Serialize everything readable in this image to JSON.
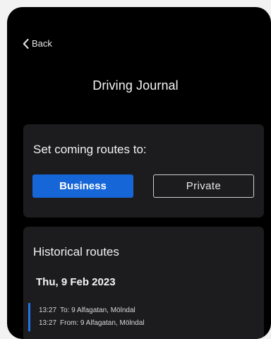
{
  "nav": {
    "back_label": "Back"
  },
  "header": {
    "title": "Driving Journal"
  },
  "routes_setting": {
    "heading": "Set coming routes to:",
    "options": [
      "Business",
      "Private"
    ],
    "selected": "Business"
  },
  "history": {
    "heading": "Historical routes",
    "days": [
      {
        "date": "Thu, 9 Feb 2023",
        "trips": [
          {
            "lines": [
              {
                "time": "13:27",
                "text": "To: 9 Alfagatan, Mölndal"
              },
              {
                "time": "13:27",
                "text": "From: 9 Alfagatan, Mölndal"
              }
            ]
          }
        ]
      }
    ]
  },
  "colors": {
    "accent": "#1666d8",
    "background": "#000000",
    "card": "#1c1c1e",
    "trip_marker": "#1e74ea"
  },
  "icons": {
    "back": "chevron-left-icon"
  }
}
